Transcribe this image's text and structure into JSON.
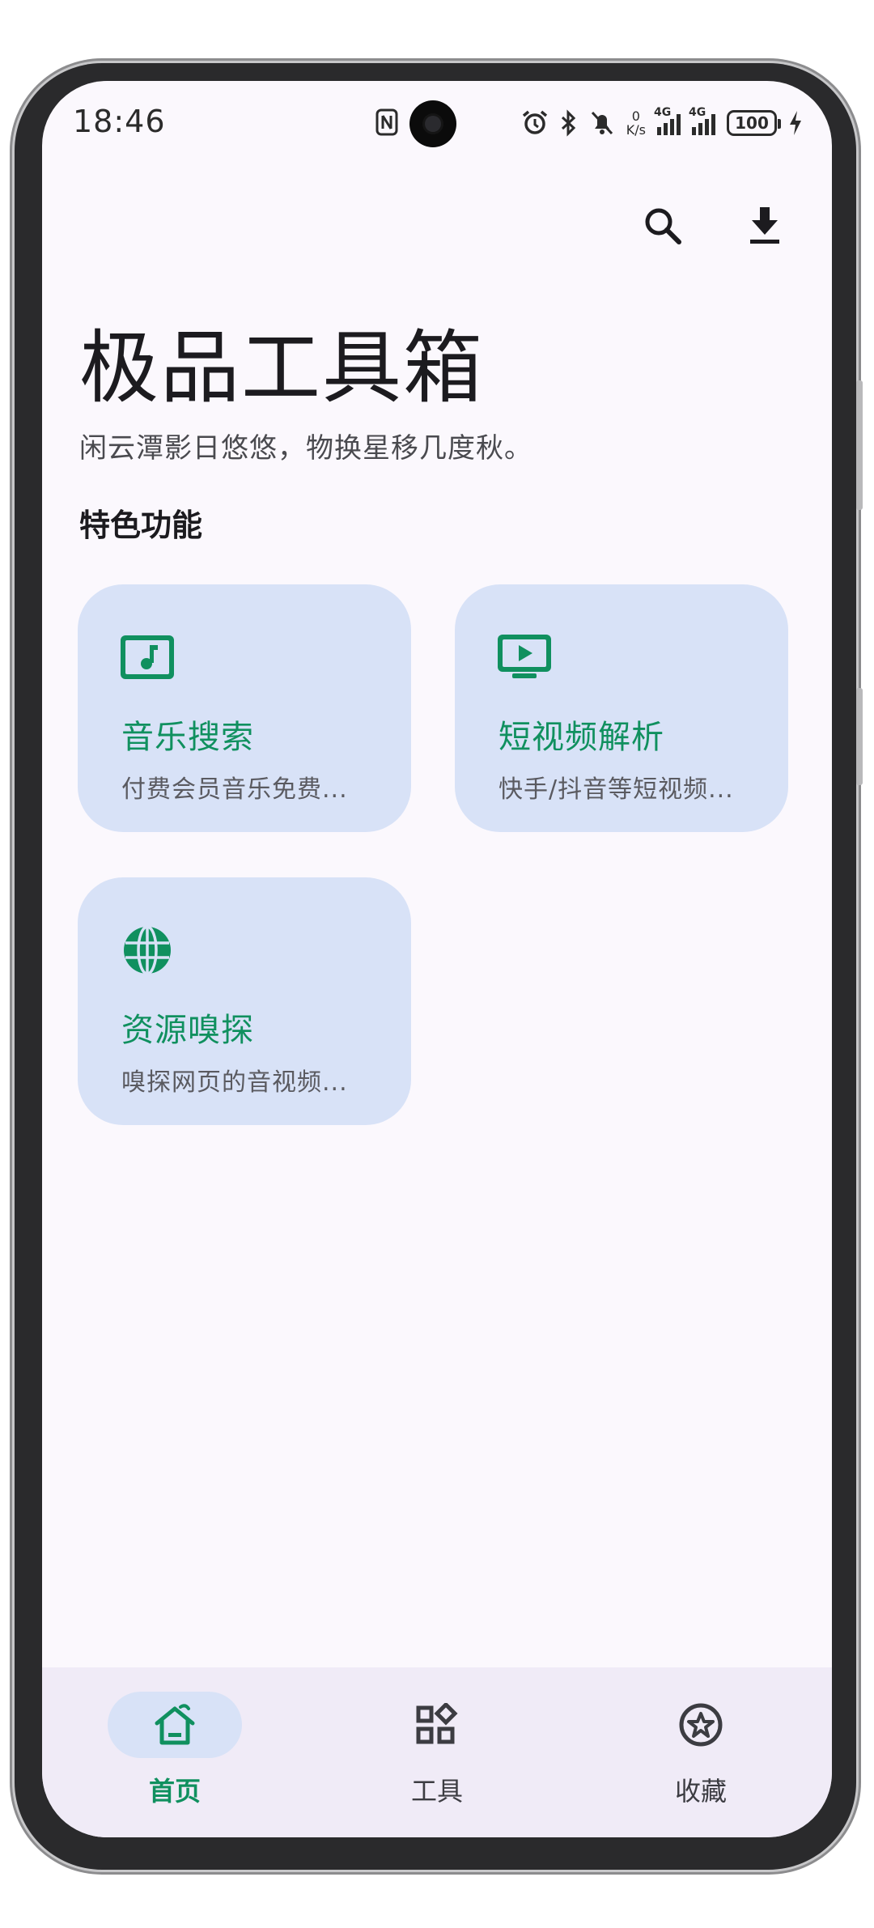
{
  "status_bar": {
    "time": "18:46",
    "net_speed_value": "0",
    "net_speed_unit": "K/s",
    "signal1_label": "4G",
    "signal2_label": "4G",
    "battery": "100"
  },
  "app": {
    "title": "极品工具箱",
    "subtitle": "闲云潭影日悠悠，物换星移几度秋。",
    "section_title": "特色功能"
  },
  "features": [
    {
      "title": "音乐搜索",
      "desc": "付费会员音乐免费...",
      "icon": "music-note-icon"
    },
    {
      "title": "短视频解析",
      "desc": "快手/抖音等短视频...",
      "icon": "play-screen-icon"
    },
    {
      "title": "资源嗅探",
      "desc": "嗅探网页的音视频...",
      "icon": "globe-icon"
    }
  ],
  "bottom_nav": [
    {
      "label": "首页",
      "icon": "home-icon",
      "active": true
    },
    {
      "label": "工具",
      "icon": "widgets-icon",
      "active": false
    },
    {
      "label": "收藏",
      "icon": "star-circle-icon",
      "active": false
    }
  ],
  "colors": {
    "accent": "#10905f",
    "card_bg": "#d8e2f7",
    "screen_bg": "#fbf8fd",
    "nav_bg": "#f0ebf7"
  }
}
